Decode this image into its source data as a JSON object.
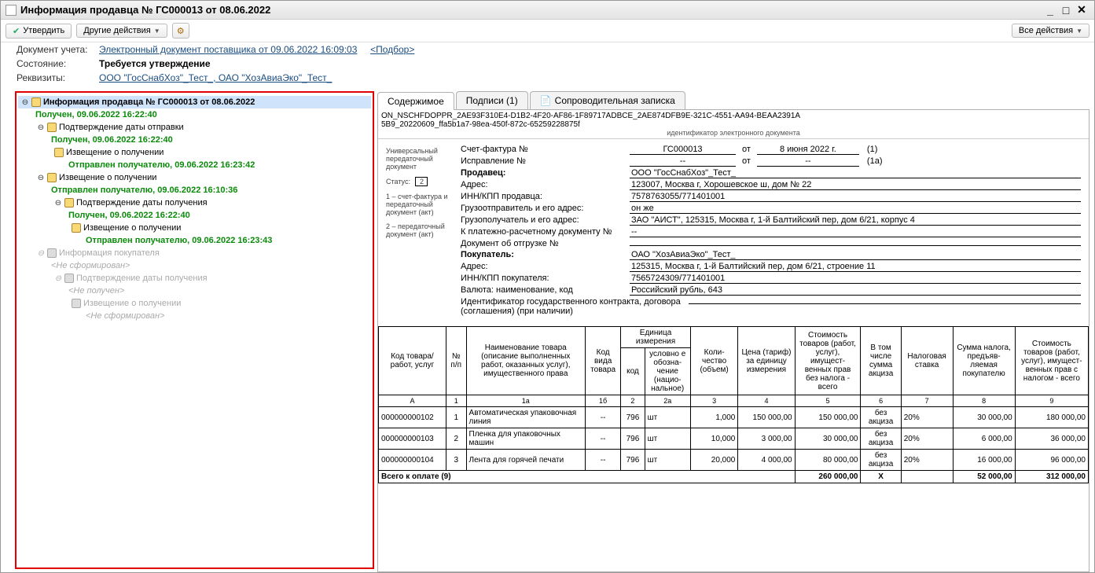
{
  "window": {
    "title": "Информация продавца № ГС000013 от 08.06.2022"
  },
  "toolbar": {
    "approve": "Утвердить",
    "other_actions": "Другие действия",
    "all_actions": "Все действия"
  },
  "meta": {
    "doc_label": "Документ учета:",
    "doc_link": "Электронный документ поставщика  от 09.06.2022 16:09:03",
    "select_link": "<Подбор>",
    "state_label": "Состояние:",
    "state_value": "Требуется утверждение",
    "req_label": "Реквизиты:",
    "req_link": "ООО \"ГосСнабХоз\"_Тест_, ОАО \"ХозАвиаЭко\"_Тест_"
  },
  "tree": {
    "root_title": "Информация продавца № ГС000013 от 08.06.2022",
    "root_status": "Получен, 09.06.2022 16:22:40",
    "n1": "Подтверждение даты отправки",
    "n1s": "Получен, 09.06.2022 16:22:40",
    "n1_1": "Извещение о получении",
    "n1_1s": "Отправлен получателю, 09.06.2022 16:23:42",
    "n2": "Извещение о получении",
    "n2s": "Отправлен получателю, 09.06.2022 16:10:36",
    "n2_1": "Подтверждение даты получения",
    "n2_1s": "Получен, 09.06.2022 16:22:40",
    "n2_1_1": "Извещение о получении",
    "n2_1_1s": "Отправлен получателю, 09.06.2022 16:23:43",
    "g1": "Информация покупателя",
    "g1s": "<Не сформирован>",
    "g1_1": "Подтверждение даты получения",
    "g1_1s": "<Не получен>",
    "g1_1_1": "Извещение о получении",
    "g1_1_1s": "<Не сформирован>"
  },
  "tabs": {
    "content": "Содержимое",
    "signs": "Подписи (1)",
    "note": "Сопроводительная записка"
  },
  "docid": {
    "l1": "ON_NSCHFDOPPR_2AE93F310E4-D1B2-4F20-AF86-1F89717ADBCE_2AE874DFB9E-321C-4551-AA94-BEAA2391A",
    "l2": "5B9_20220609_ffa5b1a7-98ea-450f-872c-65259228875f",
    "caption": "идентификатор электронного документа"
  },
  "side": {
    "a": "Универсальный передаточный документ",
    "status_label": "Статус:",
    "status_val": "2",
    "b": "1 – счет-фактура и передаточный документ (акт)",
    "c": "2 – передаточный документ (акт)"
  },
  "form": {
    "sf_label": "Счет-фактура №",
    "sf_no": "ГС000013",
    "sf_ot": "от",
    "sf_date": "8 июня 2022 г.",
    "sf_tail": "(1)",
    "isp_label": "Исправление №",
    "isp_no": "--",
    "isp_ot": "от",
    "isp_date": "--",
    "isp_tail": "(1а)",
    "seller_label": "Продавец:",
    "seller_val": "ООО \"ГосСнабХоз\"_Тест_",
    "addr_label": "Адрес:",
    "addr_val": "123007, Москва г, Хорошевское ш, дом № 22",
    "innkpp_s_label": "ИНН/КПП продавца:",
    "innkpp_s_val": "7578763055/771401001",
    "shipper_label": "Грузоотправитель и его адрес:",
    "shipper_val": "он же",
    "consignee_label": "Грузополучатель и его адрес:",
    "consignee_val": "ЗАО \"АИСТ\", 125315, Москва г, 1-й Балтийский пер, дом 6/21, корпус 4",
    "paydoc_label": "К платежно-расчетному документу №",
    "paydoc_val": "--",
    "shipdoc_label": "Документ об отгрузке №",
    "shipdoc_val": "",
    "buyer_label": "Покупатель:",
    "buyer_val": "ОАО \"ХозАвиаЭко\"_Тест_",
    "baddr_label": "Адрес:",
    "baddr_val": "125315, Москва г, 1-й Балтийский пер, дом 6/21, строение 11",
    "innkpp_b_label": "ИНН/КПП покупателя:",
    "innkpp_b_val": "7565724309/771401001",
    "cur_label": "Валюта: наименование, код",
    "cur_val": "Российский рубль, 643",
    "gov_label": "Идентификатор государственного контракта, договора (соглашения) (при наличии)",
    "gov_val": ""
  },
  "thead": {
    "c1": "Код товара/ работ, услуг",
    "c2": "№ п/п",
    "c3": "Наименование товара (описание выполненных работ, оказанных услуг), имущественного права",
    "c4": "Код вида товара",
    "c5": "Единица измерения",
    "c5a": "код",
    "c5b": "условно е обозна-чение (нацио-нальное)",
    "c6": "Коли-чество (объем)",
    "c7": "Цена (тариф) за единицу измерения",
    "c8": "Стоимость товаров (работ, услуг), имущест-венных прав без налога - всего",
    "c9": "В том числе сумма акциза",
    "c10": "Налоговая ставка",
    "c11": "Сумма налога, предъяв-ляемая покупателю",
    "c12": "Стоимость товаров (работ, услуг), имущест-венных прав с налогом - всего"
  },
  "numrow": {
    "c1": "А",
    "c2": "1",
    "c3": "1а",
    "c4": "1б",
    "c5a": "2",
    "c5b": "2а",
    "c6": "3",
    "c7": "4",
    "c8": "5",
    "c9": "6",
    "c10": "7",
    "c11": "8",
    "c12": "9"
  },
  "rows": [
    {
      "code": "000000000102",
      "n": "1",
      "name": "Автоматическая упаковочная линия",
      "kvid": "--",
      "ucode": "796",
      "un": "шт",
      "qty": "1,000",
      "price": "150 000,00",
      "sum": "150 000,00",
      "excise": "без акциза",
      "rate": "20%",
      "tax": "30 000,00",
      "total": "180 000,00"
    },
    {
      "code": "000000000103",
      "n": "2",
      "name": "Пленка для упаковочных машин",
      "kvid": "--",
      "ucode": "796",
      "un": "шт",
      "qty": "10,000",
      "price": "3 000,00",
      "sum": "30 000,00",
      "excise": "без акциза",
      "rate": "20%",
      "tax": "6 000,00",
      "total": "36 000,00"
    },
    {
      "code": "000000000104",
      "n": "3",
      "name": "Лента для горячей печати",
      "kvid": "--",
      "ucode": "796",
      "un": "шт",
      "qty": "20,000",
      "price": "4 000,00",
      "sum": "80 000,00",
      "excise": "без акциза",
      "rate": "20%",
      "tax": "16 000,00",
      "total": "96 000,00"
    }
  ],
  "total": {
    "label": "Всего к оплате (9)",
    "sum": "260 000,00",
    "x": "X",
    "tax": "52 000,00",
    "grand": "312 000,00"
  }
}
